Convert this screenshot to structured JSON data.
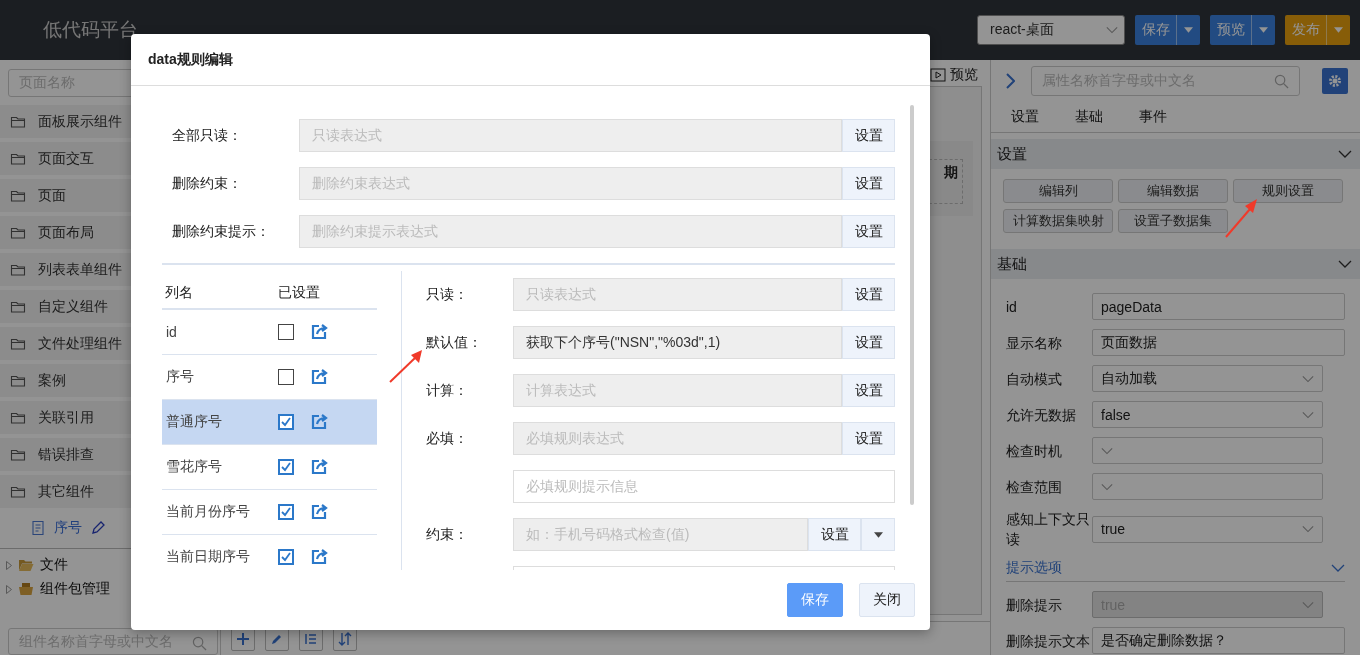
{
  "top_bar": {
    "logo": "低代码平台",
    "platform_select": "react-桌面",
    "buttons": [
      {
        "label": "保存",
        "kind": "primary"
      },
      {
        "label": "预览",
        "kind": "primary"
      },
      {
        "label": "发布",
        "kind": "warning"
      }
    ]
  },
  "left_sidebar": {
    "search": {
      "placeholder": "页面名称"
    },
    "folders": [
      "面板展示组件",
      "页面交互",
      "页面",
      "页面布局",
      "列表表单组件",
      "自定义组件",
      "文件处理组件",
      "案例",
      "关联引用",
      "错误排查",
      "其它组件"
    ],
    "current_page": "序号",
    "tree": [
      {
        "label": "文件",
        "kind": "folder"
      },
      {
        "label": "组件包管理",
        "kind": "package"
      }
    ],
    "component_search": {
      "placeholder": "组件名称首字母或中文名"
    }
  },
  "canvas": {
    "preview_button": "预览",
    "partial_header": "期"
  },
  "right_panel": {
    "search": {
      "placeholder": "属性名称首字母或中文名"
    },
    "tabs": [
      "设置",
      "基础",
      "事件"
    ],
    "settings_section": {
      "title": "设置",
      "buttons": [
        "编辑列",
        "编辑数据",
        "规则设置",
        "计算数据集映射",
        "设置子数据集"
      ]
    },
    "basic_section": {
      "title": "基础",
      "properties": [
        {
          "label": "id",
          "value": "pageData",
          "kind": "input",
          "disabled": false
        },
        {
          "label": "显示名称",
          "value": "页面数据",
          "kind": "input",
          "disabled": false
        },
        {
          "label": "自动模式",
          "value": "自动加载",
          "kind": "select",
          "disabled": false
        },
        {
          "label": "允许无数据",
          "value": "false",
          "kind": "select",
          "disabled": false
        },
        {
          "label": "检查时机",
          "kind": "select",
          "disabled": false
        },
        {
          "label": "检查范围",
          "kind": "select",
          "disabled": false
        },
        {
          "label": "感知上下文只读",
          "value": "true",
          "kind": "select",
          "disabled": false
        }
      ]
    },
    "hint_section": {
      "title": "提示选项",
      "properties": [
        {
          "label": "删除提示",
          "value": "true",
          "kind": "select",
          "disabled": true
        },
        {
          "label": "删除提示文本",
          "value": "是否确定删除数据？",
          "kind": "input",
          "disabled": false
        }
      ]
    }
  },
  "dialog": {
    "title": "data规则编辑",
    "top_rules": [
      {
        "label": "全部只读：",
        "placeholder": "只读表达式",
        "button": "设置"
      },
      {
        "label": "删除约束：",
        "placeholder": "删除约束表达式",
        "button": "设置"
      },
      {
        "label": "删除约束提示：",
        "placeholder": "删除约束提示表达式",
        "button": "设置"
      }
    ],
    "columns_table": {
      "headers": [
        "列名",
        "已设置"
      ],
      "rows": [
        {
          "name": "id",
          "checked": false,
          "selected": false
        },
        {
          "name": "序号",
          "checked": false,
          "selected": false
        },
        {
          "name": "普通序号",
          "checked": true,
          "selected": true
        },
        {
          "name": "雪花序号",
          "checked": true,
          "selected": false
        },
        {
          "name": "当前月份序号",
          "checked": true,
          "selected": false
        },
        {
          "name": "当前日期序号",
          "checked": true,
          "selected": false
        }
      ]
    },
    "rule_fields": [
      {
        "kind": "expression",
        "label": "只读：",
        "placeholder": "只读表达式",
        "button": "设置"
      },
      {
        "kind": "expression",
        "label": "默认值：",
        "value": "获取下个序号(\"NSN\",\"%03d\",1)",
        "button": "设置"
      },
      {
        "kind": "expression",
        "label": "计算：",
        "placeholder": "计算表达式",
        "button": "设置"
      },
      {
        "kind": "expression",
        "label": "必填：",
        "placeholder": "必填规则表达式",
        "button": "设置"
      },
      {
        "kind": "text",
        "placeholder": "必填规则提示信息"
      },
      {
        "kind": "expression_dropdown",
        "label": "约束：",
        "placeholder": "如：手机号码格式检查(值)",
        "button": "设置"
      },
      {
        "kind": "text"
      }
    ],
    "footer_buttons": [
      {
        "label": "保存",
        "kind": "primary"
      },
      {
        "label": "关闭",
        "kind": "default"
      }
    ]
  }
}
